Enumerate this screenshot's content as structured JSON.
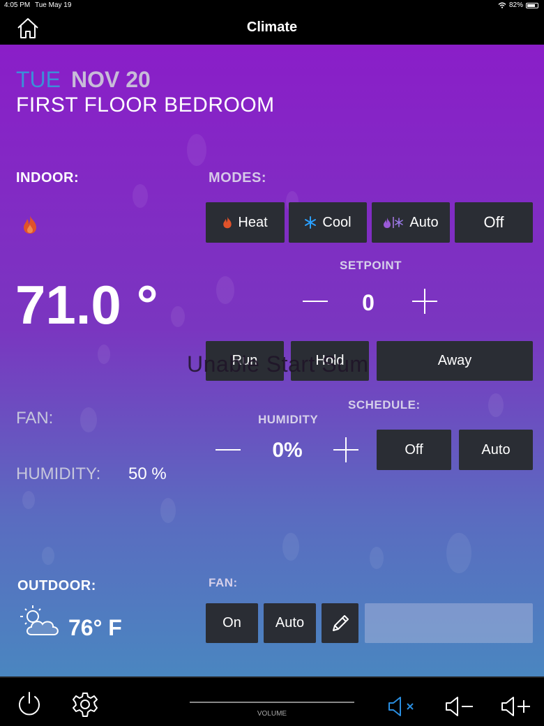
{
  "status_bar": {
    "time": "4:05 PM",
    "date": "Tue May 19",
    "battery": "82%"
  },
  "header": {
    "title": "Climate"
  },
  "date": {
    "day": "TUE",
    "date": "NOV 20"
  },
  "room": "FIRST FLOOR BEDROOM",
  "indoor": {
    "label": "INDOOR:",
    "temperature": "71.0 °",
    "fan_label": "FAN:",
    "humidity_label": "HUMIDITY:",
    "humidity_value": "50 %"
  },
  "outdoor": {
    "label": "OUTDOOR:",
    "temperature": "76° F"
  },
  "modes": {
    "label": "MODES:",
    "heat": "Heat",
    "cool": "Cool",
    "auto": "Auto",
    "off": "Off"
  },
  "setpoint": {
    "label": "SETPOINT",
    "value": "0"
  },
  "hold": {
    "run": "Run",
    "hold": "Hold",
    "away": "Away"
  },
  "overlay_text": "Unable Start Sum",
  "schedule": {
    "label": "SCHEDULE:",
    "off": "Off",
    "auto": "Auto"
  },
  "humidity_ctrl": {
    "label": "HUMIDITY",
    "value": "0%"
  },
  "fan_ctrl": {
    "label": "FAN:",
    "on": "On",
    "auto": "Auto"
  },
  "footer": {
    "volume_label": "VOLUME"
  },
  "colors": {
    "background_top": "#8a1ec8",
    "background_bottom": "#4a86c0",
    "button": "#2a2d34",
    "day": "#3c8ed8",
    "heat_icon": "#e0522a",
    "cool_icon": "#2aa0ff",
    "mute_active": "#2a8ee0"
  },
  "icons": [
    "home-icon",
    "flame-icon",
    "snowflake-icon",
    "auto-mode-icon",
    "pencil-icon",
    "weather-sun-cloud-icon",
    "power-icon",
    "gear-icon",
    "mute-icon",
    "volume-down-icon",
    "volume-up-icon",
    "wifi-icon",
    "battery-icon"
  ]
}
